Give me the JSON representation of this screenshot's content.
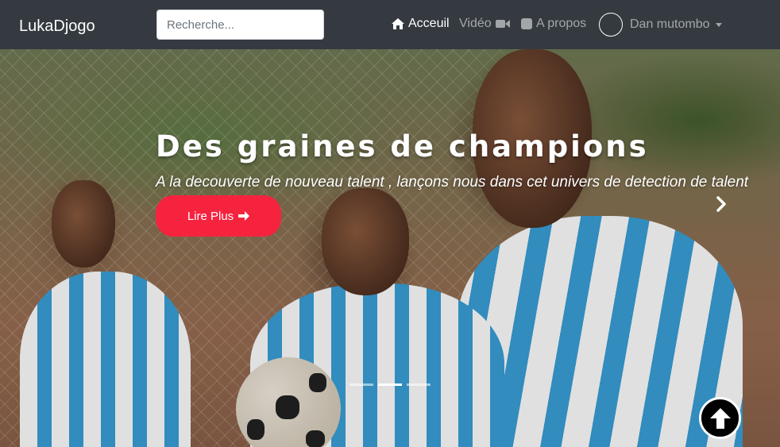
{
  "navbar": {
    "brand": "LukaDjogo",
    "search": {
      "placeholder": "Recherche...",
      "value": ""
    },
    "links": [
      {
        "label": "Acceuil",
        "icon": "home-icon",
        "active": true
      },
      {
        "label": "Vidéo",
        "icon": "video-camera-icon",
        "active": false
      },
      {
        "label": "A propos",
        "icon": "square-icon",
        "active": false
      }
    ],
    "user": {
      "name": "Dan mutombo",
      "icon": "avatar-circle-icon",
      "dropdown_icon": "caret-down-icon"
    }
  },
  "hero": {
    "title": "Des graines de champions",
    "subtitle": "A la decouverte de nouveau talent , lançons nous dans cet univers de detection de talent",
    "cta_label": "Lire Plus",
    "cta_icon": "arrow-right-icon",
    "next_icon": "chevron-right-icon",
    "slides": {
      "count": 3,
      "active_index": 1
    },
    "image_description": "football players in striped jerseys"
  },
  "scroll_top": {
    "icon": "arrow-up-icon"
  },
  "colors": {
    "navbar_bg": "#343a40",
    "cta_bg": "#f6233f",
    "text_light": "#ffffff",
    "muted_link": "rgba(255,255,255,0.55)"
  }
}
